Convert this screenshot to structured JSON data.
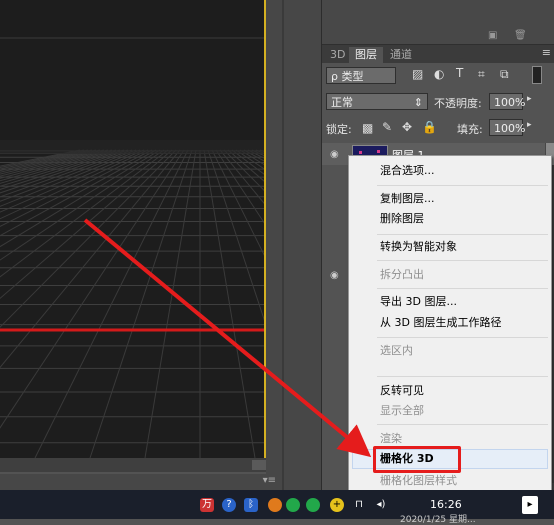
{
  "panel": {
    "tabs": [
      "3D",
      "图层",
      "通道"
    ],
    "active_tab": "图层",
    "tab_menu": "≡",
    "filter_kind": "ρ 类型",
    "filter_icons": [
      "image-icon",
      "adjust-icon",
      "text-icon",
      "shape-icon",
      "smart-object-icon"
    ],
    "blend_mode": "正常",
    "opacity_label": "不透明度:",
    "opacity_value": "100%",
    "lock_label": "锁定:",
    "fill_label": "填充:",
    "fill_value": "100%",
    "layer_name": "图层 1"
  },
  "context_menu": {
    "items": [
      {
        "label": "混合选项...",
        "enabled": true
      },
      {
        "label": "复制图层...",
        "enabled": true
      },
      {
        "label": "删除图层",
        "enabled": true
      },
      {
        "label": "转换为智能对象",
        "enabled": true
      },
      {
        "label": "拆分凸出",
        "enabled": false
      },
      {
        "label": "导出 3D 图层...",
        "enabled": true
      },
      {
        "label": "从 3D 图层生成工作路径",
        "enabled": true
      },
      {
        "label": "选区内",
        "enabled": false
      },
      {
        "label": "反转可见",
        "enabled": true
      },
      {
        "label": "显示全部",
        "enabled": false
      },
      {
        "label": "渲染",
        "enabled": false
      },
      {
        "label": "栅格化 3D",
        "enabled": true,
        "highlighted": true
      },
      {
        "label": "栅格化图层样式",
        "enabled": false
      }
    ]
  },
  "taskbar": {
    "time": "16:26",
    "date_partial": "2020/1/25 星期..."
  },
  "colors": {
    "annotation": "#e51c1c",
    "document_border": "#d4b022",
    "grid_line": "#d41a1a"
  }
}
